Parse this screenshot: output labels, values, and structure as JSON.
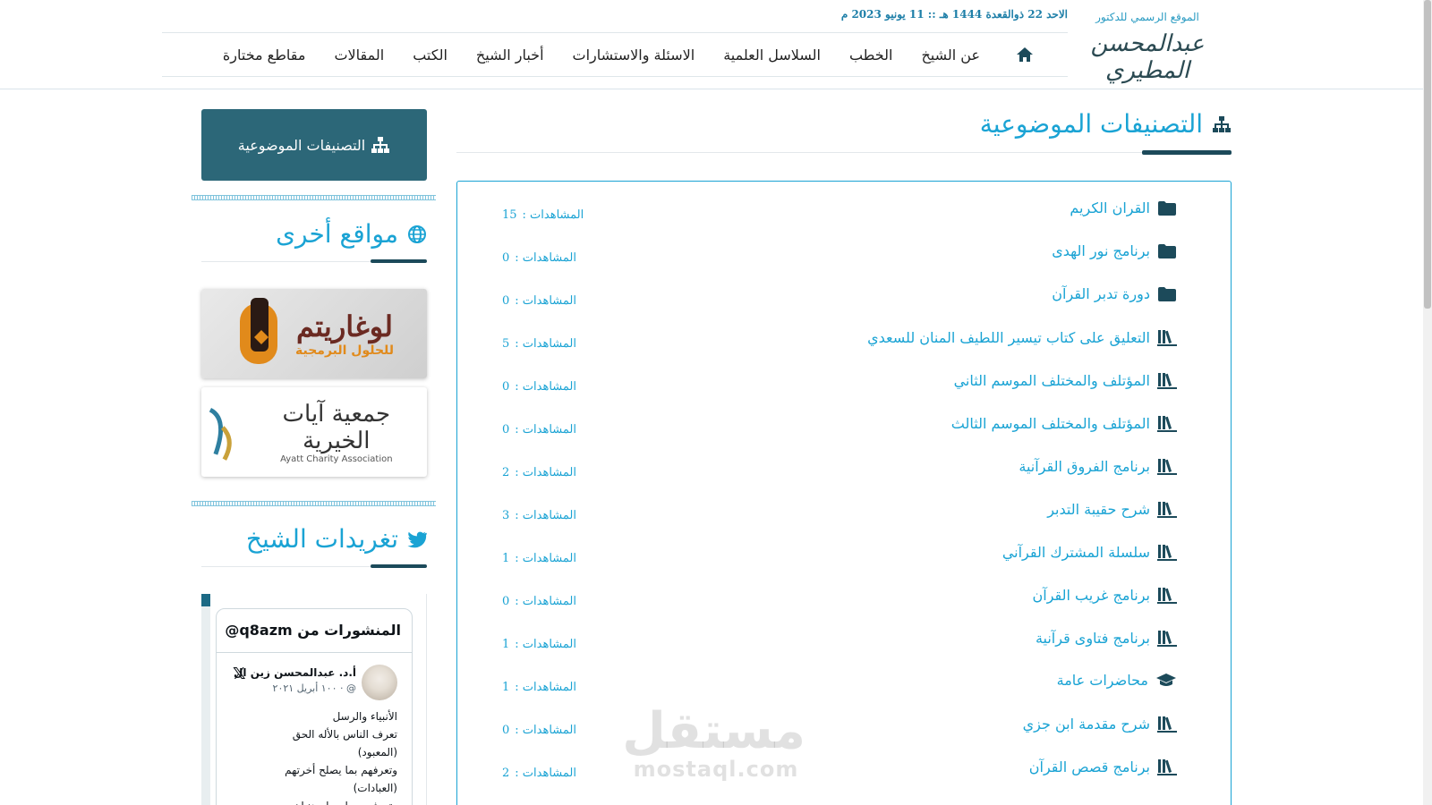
{
  "header": {
    "tagline": "الموقع الرسمي للدكتور",
    "logo_text": "عبدالمحسن المطيري",
    "date": "الاحد 22 ذوالقعدة 1444 هـ :: 11 يونيو 2023 م",
    "nav": [
      {
        "label": "عن الشيخ"
      },
      {
        "label": "الخطب"
      },
      {
        "label": "السلاسل العلمية"
      },
      {
        "label": "الاسئلة والاستشارات"
      },
      {
        "label": "أخبار الشيخ"
      },
      {
        "label": "الكتب"
      },
      {
        "label": "المقالات"
      },
      {
        "label": "مقاطع مختارة"
      }
    ]
  },
  "main": {
    "title": "التصنيفات الموضوعية",
    "categories": [
      {
        "name": "القران الكريم",
        "icon": "folder-icon",
        "views_label": "المشاهدات :",
        "views": "15"
      },
      {
        "name": "برنامج نور الهدى",
        "icon": "folder-icon",
        "views_label": "المشاهدات :",
        "views": "0"
      },
      {
        "name": "دورة تدبر القرآن",
        "icon": "folder-icon",
        "views_label": "المشاهدات :",
        "views": "0"
      },
      {
        "name": "التعليق على كتاب تيسير اللطيف المنان للسعدي",
        "icon": "books-icon",
        "views_label": "المشاهدات :",
        "views": "5"
      },
      {
        "name": "المؤتلف والمختلف الموسم الثاني",
        "icon": "books-icon",
        "views_label": "المشاهدات :",
        "views": "0"
      },
      {
        "name": "المؤتلف والمختلف الموسم الثالث",
        "icon": "books-icon",
        "views_label": "المشاهدات :",
        "views": "0"
      },
      {
        "name": "برنامج الفروق القرآنية",
        "icon": "books-icon",
        "views_label": "المشاهدات :",
        "views": "2"
      },
      {
        "name": "شرح حقيبة التدبر",
        "icon": "books-icon",
        "views_label": "المشاهدات :",
        "views": "3"
      },
      {
        "name": "سلسلة المشترك القرآني",
        "icon": "books-icon",
        "views_label": "المشاهدات :",
        "views": "1"
      },
      {
        "name": "برنامج غريب القرآن",
        "icon": "books-icon",
        "views_label": "المشاهدات :",
        "views": "0"
      },
      {
        "name": "برنامج فتاوى قرآنية",
        "icon": "books-icon",
        "views_label": "المشاهدات :",
        "views": "1"
      },
      {
        "name": "محاضرات عامة",
        "icon": "graduation-cap-icon",
        "views_label": "المشاهدات :",
        "views": "1"
      },
      {
        "name": "شرح مقدمة ابن جزي",
        "icon": "books-icon",
        "views_label": "المشاهدات :",
        "views": "0"
      },
      {
        "name": "برنامج قصص القرآن",
        "icon": "books-icon",
        "views_label": "المشاهدات :",
        "views": "2"
      }
    ]
  },
  "sidebar": {
    "button_label": "التصنيفات الموضوعية",
    "other_sites_title": "مواقع أخرى",
    "ad1": {
      "brand": "لوغاريتم",
      "sub": "للحلول البرمجية"
    },
    "ad2": {
      "brand": "جمعية آيات الخيرية",
      "sub": "Ayatt Charity Association"
    },
    "tweets_title": "تغريدات الشيخ"
  },
  "tweet": {
    "header": "المنشورات من q8azm@",
    "author": "أ.د. عبدالمحسن زين ال",
    "meta": "@ · ١٠٠ أبريل ٢٠٢١",
    "body": "الأنبياء والرسل\nتعرف الناس بالأله الحق\n(المعبود)\nوتعرفهم بما يصلح أخرتهم\n(العبادات)\nوتعرفهم بما يصلح دنياهم"
  },
  "watermark": {
    "ar": "مستقل",
    "en": "mostaql.com"
  },
  "colors": {
    "accent": "#1aa3d4",
    "dark": "#1c4a5a",
    "button": "#2c6778"
  }
}
